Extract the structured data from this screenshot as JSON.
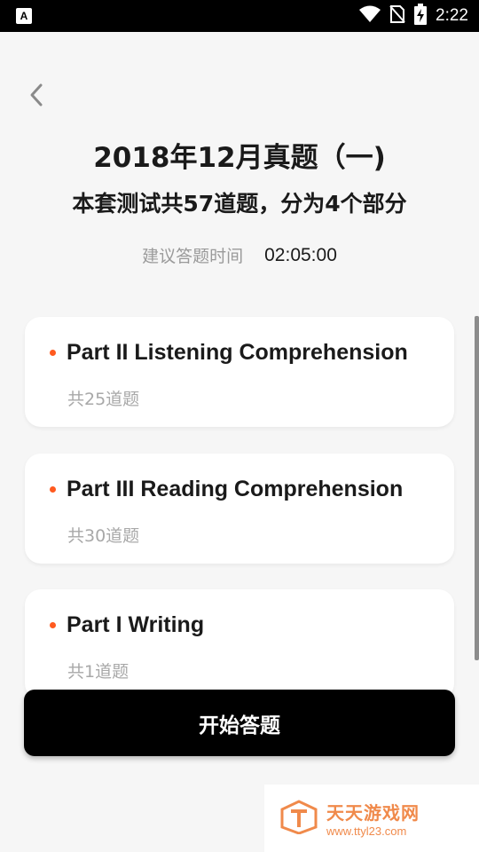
{
  "status_bar": {
    "notification_icon": "A",
    "time": "2:22",
    "icons": [
      "wifi-icon",
      "no-sim-icon",
      "battery-charging-icon"
    ]
  },
  "header": {
    "back_icon": "chevron-left-icon",
    "title": "2018年12月真题（一)",
    "subtitle": "本套测试共57道题，分为4个部分",
    "time_label": "建议答题时间",
    "time_value": "02:05:00"
  },
  "parts": [
    {
      "title": "Part II Listening Comprehension",
      "count": "共25道题"
    },
    {
      "title": "Part III Reading Comprehension",
      "count": "共30道题"
    },
    {
      "title": "Part I Writing",
      "count": "共1道题"
    }
  ],
  "start_button": {
    "label": "开始答题"
  },
  "watermark": {
    "name": "天天游戏网",
    "url": "www.ttyl23.com"
  },
  "colors": {
    "accent": "#ff5a1f",
    "button": "#000000",
    "background": "#f6f6f6",
    "watermark": "#f08a4b"
  }
}
